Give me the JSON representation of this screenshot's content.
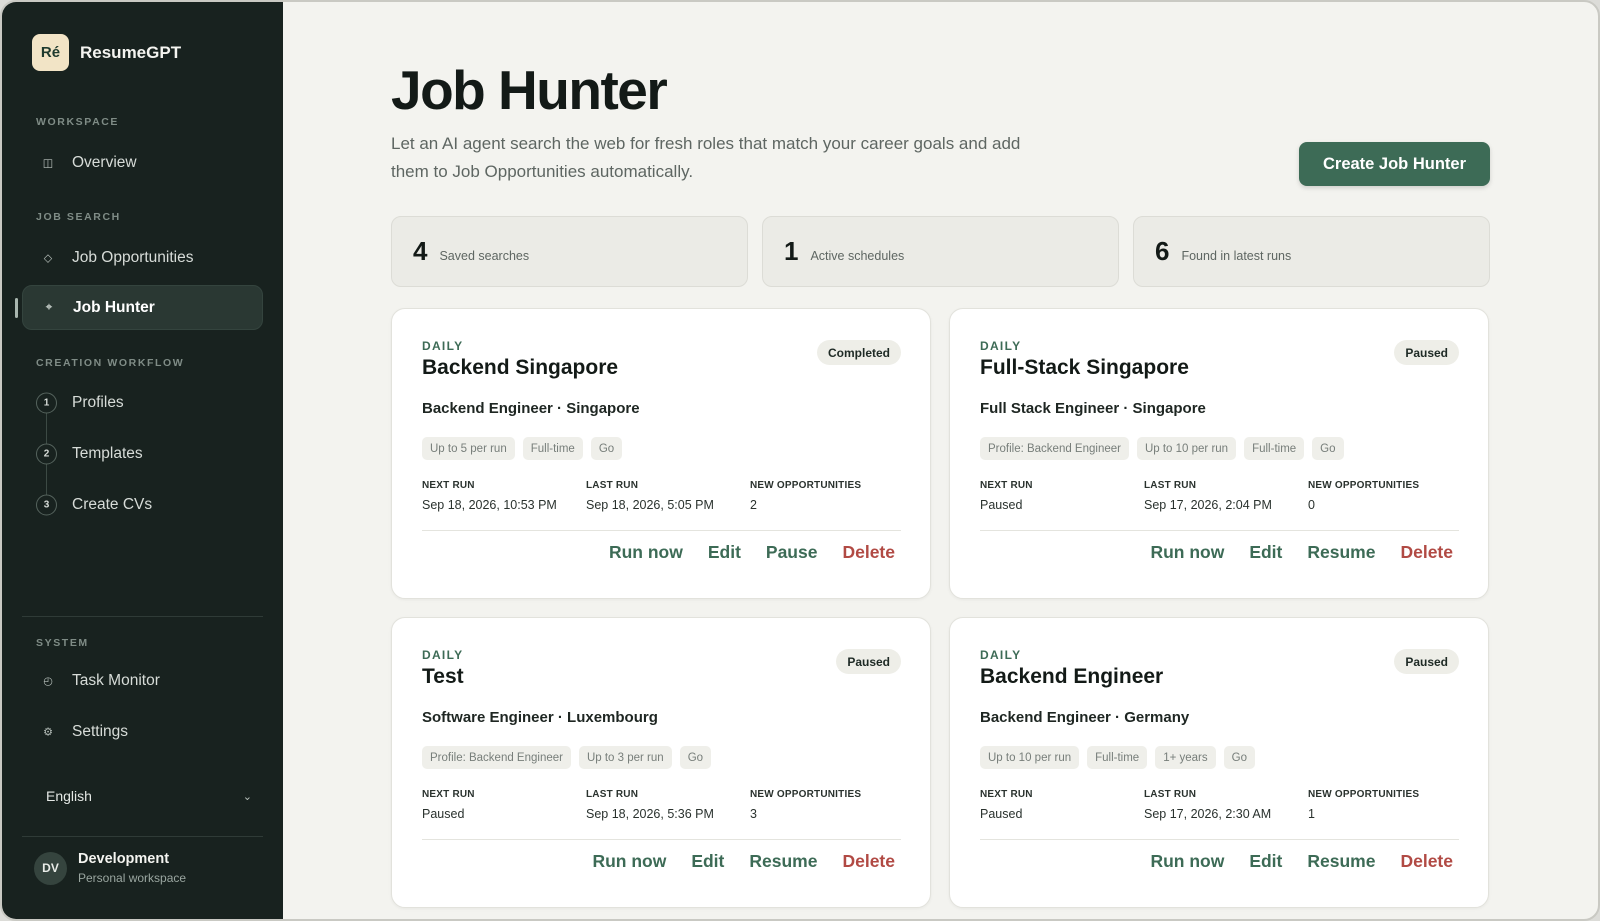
{
  "brand": {
    "logo": "Ré",
    "name": "ResumeGPT"
  },
  "sidebar": {
    "sections": {
      "workspace": "WORKSPACE",
      "job_search": "JOB SEARCH",
      "creation_workflow": "CREATION WORKFLOW",
      "system": "SYSTEM"
    },
    "items": [
      {
        "label": "Overview",
        "icon": "layout-icon"
      },
      {
        "label": "Job Opportunities",
        "icon": "diamond-icon"
      },
      {
        "label": "Job Hunter",
        "icon": "crosshair-icon",
        "active": true
      },
      {
        "label": "Profiles",
        "step": "1"
      },
      {
        "label": "Templates",
        "step": "2"
      },
      {
        "label": "Create CVs",
        "step": "3"
      },
      {
        "label": "Task Monitor",
        "icon": "clock-icon"
      },
      {
        "label": "Settings",
        "icon": "gear-icon"
      }
    ],
    "language": "English",
    "user": {
      "initials": "DV",
      "name": "Development",
      "subtitle": "Personal workspace"
    }
  },
  "main": {
    "title": "Job Hunter",
    "description": "Let an AI agent search the web for fresh roles that match your career goals and add them to Job Opportunities automatically.",
    "create_button": "Create Job Hunter",
    "stats": [
      {
        "value": "4",
        "label": "Saved searches"
      },
      {
        "value": "1",
        "label": "Active schedules"
      },
      {
        "value": "6",
        "label": "Found in latest runs"
      }
    ],
    "meta_labels": {
      "next_run": "NEXT RUN",
      "last_run": "LAST RUN",
      "new_opps": "NEW OPPORTUNITIES"
    },
    "cards": [
      {
        "frequency": "DAILY",
        "title": "Backend Singapore",
        "status": "Completed",
        "subtitle": "Backend Engineer · Singapore",
        "chips": [
          "Up to 5 per run",
          "Full-time",
          "Go"
        ],
        "next_run": "Sep 18, 2026, 10:53 PM",
        "last_run": "Sep 18, 2026, 5:05 PM",
        "new_opportunities": "2",
        "actions": {
          "run": "Run now",
          "edit": "Edit",
          "toggle": "Pause",
          "delete": "Delete"
        }
      },
      {
        "frequency": "DAILY",
        "title": "Full-Stack Singapore",
        "status": "Paused",
        "subtitle": "Full Stack Engineer · Singapore",
        "chips": [
          "Profile: Backend Engineer",
          "Up to 10 per run",
          "Full-time",
          "Go"
        ],
        "next_run": "Paused",
        "last_run": "Sep 17, 2026, 2:04 PM",
        "new_opportunities": "0",
        "actions": {
          "run": "Run now",
          "edit": "Edit",
          "toggle": "Resume",
          "delete": "Delete"
        }
      },
      {
        "frequency": "DAILY",
        "title": "Test",
        "status": "Paused",
        "subtitle": "Software Engineer · Luxembourg",
        "chips": [
          "Profile: Backend Engineer",
          "Up to 3 per run",
          "Go"
        ],
        "next_run": "Paused",
        "last_run": "Sep 18, 2026, 5:36 PM",
        "new_opportunities": "3",
        "actions": {
          "run": "Run now",
          "edit": "Edit",
          "toggle": "Resume",
          "delete": "Delete"
        }
      },
      {
        "frequency": "DAILY",
        "title": "Backend Engineer",
        "status": "Paused",
        "subtitle": "Backend Engineer · Germany",
        "chips": [
          "Up to 10 per run",
          "Full-time",
          "1+ years",
          "Go"
        ],
        "next_run": "Paused",
        "last_run": "Sep 17, 2026, 2:30 AM",
        "new_opportunities": "1",
        "actions": {
          "run": "Run now",
          "edit": "Edit",
          "toggle": "Resume",
          "delete": "Delete"
        }
      }
    ]
  },
  "colors": {
    "sidebar_bg": "#18221f",
    "accent": "#3d6b56",
    "danger": "#b14a44",
    "page_bg": "#f3f3ef"
  }
}
